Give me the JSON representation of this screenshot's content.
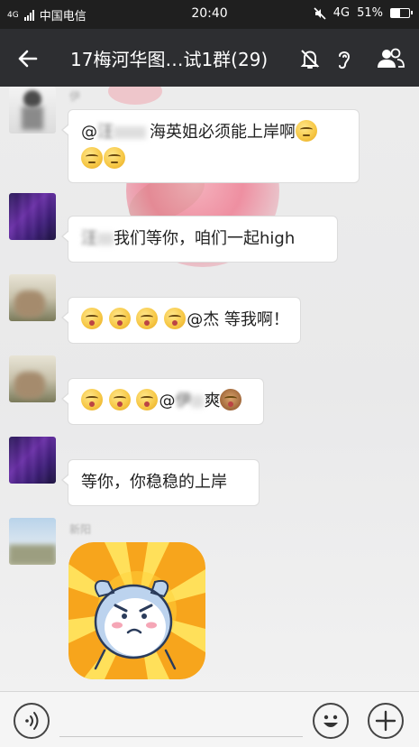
{
  "status_bar": {
    "network_type": "4G",
    "carrier": "中国电信",
    "time": "20:40",
    "network": "4G",
    "battery": "51%",
    "battery_level": 0.51
  },
  "header": {
    "title": "17梅河华图…试1群(29)",
    "icons": [
      "back-arrow-icon",
      "mute-bell-icon",
      "earpiece-icon",
      "group-members-icon"
    ]
  },
  "messages": [
    {
      "sender": "伊",
      "parts": [
        {
          "type": "text",
          "value": "@",
          "blurred": false
        },
        {
          "type": "text",
          "value": "汪",
          "blurred": true
        },
        {
          "type": "text",
          "value": "海英姐必须能上岸啊",
          "blurred": false
        },
        {
          "type": "emoji",
          "name": "smirk-emoji"
        },
        {
          "type": "emoji",
          "name": "smirk-emoji"
        },
        {
          "type": "emoji",
          "name": "smirk-emoji"
        }
      ]
    },
    {
      "sender": "",
      "parts": [
        {
          "type": "text",
          "value": "汪",
          "blurred": true
        },
        {
          "type": "text",
          "value": "我们等你，咱们一起high",
          "blurred": false
        }
      ]
    },
    {
      "sender": "",
      "parts": [
        {
          "type": "emoji",
          "name": "kiss-emoji"
        },
        {
          "type": "emoji",
          "name": "kiss-emoji"
        },
        {
          "type": "emoji",
          "name": "kiss-emoji"
        },
        {
          "type": "emoji",
          "name": "kiss-emoji"
        },
        {
          "type": "text",
          "value": "@杰 等我啊！",
          "blurred": false
        }
      ]
    },
    {
      "sender": "",
      "parts": [
        {
          "type": "emoji",
          "name": "kiss-emoji"
        },
        {
          "type": "emoji",
          "name": "kiss-emoji"
        },
        {
          "type": "emoji",
          "name": "kiss-emoji"
        },
        {
          "type": "text",
          "value": "@",
          "blurred": false
        },
        {
          "type": "text",
          "value": "伊",
          "blurred": true
        },
        {
          "type": "text",
          "value": "爽",
          "blurred": false
        },
        {
          "type": "emoji",
          "name": "see-no-evil-monkey-emoji"
        }
      ]
    },
    {
      "sender": "",
      "parts": [
        {
          "type": "text",
          "value": "等你，你稳稳的上岸",
          "blurred": false
        }
      ]
    },
    {
      "sender": "新阳",
      "parts": [
        {
          "type": "sticker",
          "name": "angry-cartoon-sticker"
        }
      ]
    }
  ],
  "input_bar": {
    "placeholder": "",
    "icons": [
      "voice-icon",
      "emoji-face-icon",
      "plus-icon"
    ]
  }
}
